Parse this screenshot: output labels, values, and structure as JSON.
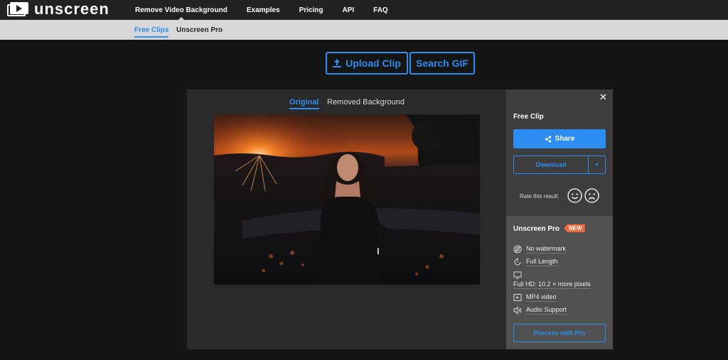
{
  "brand": {
    "name": "unscreen"
  },
  "nav": {
    "items": [
      {
        "label": "Remove Video Background",
        "active": true
      },
      {
        "label": "Examples"
      },
      {
        "label": "Pricing"
      },
      {
        "label": "API"
      },
      {
        "label": "FAQ"
      }
    ]
  },
  "subnav": {
    "items": [
      {
        "label": "Free Clips",
        "active": true
      },
      {
        "label": "Unscreen Pro"
      }
    ]
  },
  "actions": {
    "upload_label": "Upload Clip",
    "search_label": "Search GIF"
  },
  "preview": {
    "tabs": [
      {
        "label": "Original",
        "active": true
      },
      {
        "label": "Removed Background"
      }
    ]
  },
  "side": {
    "close_icon": "close-icon",
    "title": "Free Clip",
    "share_label": "Share",
    "download_label": "Download",
    "rate_label": "Rate this result:",
    "pro": {
      "title": "Unscreen Pro",
      "badge": "NEW",
      "features": [
        {
          "icon": "no-watermark-icon",
          "label": "No watermark"
        },
        {
          "icon": "full-length-icon",
          "label": "Full Length"
        },
        {
          "icon": "full-hd-icon",
          "label": "Full HD: 10.2 × more pixels"
        },
        {
          "icon": "play-icon",
          "label": "MP4 video"
        },
        {
          "icon": "speaker-icon",
          "label": "Audio Support"
        }
      ],
      "process_label": "Process with Pro"
    }
  },
  "colors": {
    "accent": "#2d8cf0",
    "badge": "#f06a3c",
    "nav_bg": "#222222",
    "subnav_bg": "#d8d8d8",
    "page_bg": "#151515"
  }
}
